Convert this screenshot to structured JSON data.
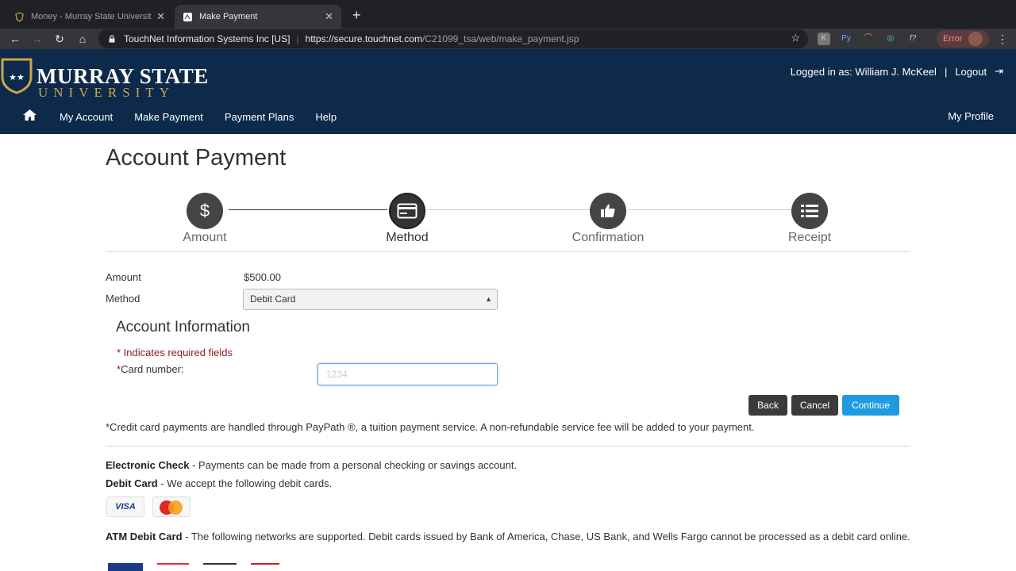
{
  "browser": {
    "tabs": [
      {
        "title": "Money - Murray State Universit",
        "active": false
      },
      {
        "title": "Make Payment",
        "active": true
      }
    ],
    "site_org": "TouchNet Information Systems Inc [US]",
    "url_host": "https://secure.touchnet.com",
    "url_path": "/C21099_tsa/web/make_payment.jsp",
    "error_label": "Error"
  },
  "header": {
    "logo_line1": "MURRAY STATE",
    "logo_line2": "UNIVERSITY",
    "logged_in": "Logged in as: William J. McKeel",
    "divider": "|",
    "logout": "Logout"
  },
  "nav": {
    "items": [
      "My Account",
      "Make Payment",
      "Payment Plans",
      "Help"
    ],
    "profile": "My Profile"
  },
  "page": {
    "title": "Account Payment",
    "steps": [
      {
        "label": "Amount",
        "icon": "dollar-icon"
      },
      {
        "label": "Method",
        "icon": "credit-card-icon"
      },
      {
        "label": "Confirmation",
        "icon": "thumbs-up-icon"
      },
      {
        "label": "Receipt",
        "icon": "list-icon"
      }
    ],
    "current_step": "Method",
    "amount_label": "Amount",
    "amount_value": "$500.00",
    "method_label": "Method",
    "method_value": "Debit Card",
    "account_info_title": "Account Information",
    "required_note": "* Indicates required fields",
    "card_number_label": "Card number:",
    "card_number_value": "1234",
    "buttons": {
      "back": "Back",
      "cancel": "Cancel",
      "continue": "Continue"
    },
    "fee_note": "*Credit card payments are handled through PayPath ®, a tuition payment service. A non-refundable service fee will be added to your payment.",
    "echeck_title": "Electronic Check",
    "echeck_text": " - Payments can be made from a personal checking or savings  account.",
    "debit_title": "Debit Card",
    "debit_text": " - We accept the following debit cards.",
    "card_brands": [
      "VISA",
      "MasterCard"
    ],
    "atm_title": "ATM Debit Card",
    "atm_text": " - The following networks are supported. Debit cards issued by Bank of America, Chase, US Bank, and Wells Fargo cannot be processed as a debit card online."
  },
  "colors": {
    "header_bg": "#0d2a4a",
    "gold": "#c9a74a",
    "continue_btn": "#1e9be0",
    "required_red": "#8b1a1a"
  }
}
